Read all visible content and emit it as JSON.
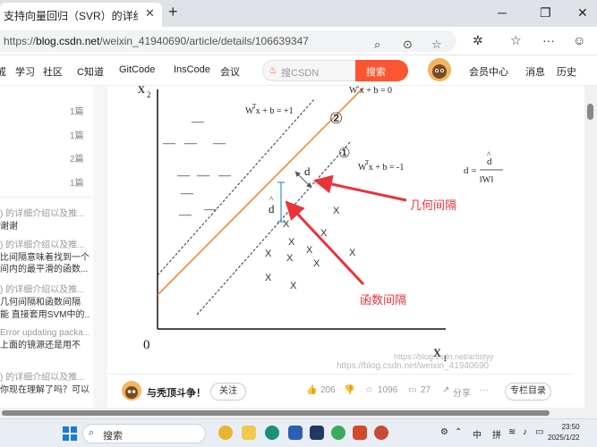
{
  "browser": {
    "tab_title": "支持向量回归（SVR）的详细介绍",
    "tab_close": "✕",
    "new_tab": "+",
    "url_prefix": "https://",
    "url_host": "blog.csdn.net",
    "url_path": "/weixin_41940690/article/details/106639347"
  },
  "header": {
    "nav": [
      "戒",
      "学习",
      "社区",
      "C知道",
      "GitCode",
      "InsCode",
      "会议"
    ],
    "search_placeholder": "搜CSDN",
    "search_button": "搜索",
    "right": [
      "会员中心",
      "消息",
      "历史"
    ]
  },
  "sidebar": {
    "counts": [
      "1篇",
      "1篇",
      "2篇",
      "1篇"
    ],
    "related": [
      {
        "text": ") 的详细介绍以及推...",
        "style": "gray"
      },
      {
        "text": "谢谢",
        "style": "dark"
      },
      {
        "text": ") 的详细介绍以及推...",
        "style": "gray"
      },
      {
        "text": "比间隔意味着找到一个",
        "style": "dark"
      },
      {
        "text": "间内的最平滑的函数...",
        "style": "dark"
      },
      {
        "text": ") 的详细介绍以及推...",
        "style": "gray"
      },
      {
        "text": "几何间隔和函数间隔",
        "style": "dark"
      },
      {
        "text": "能 直接套用SVM中的...",
        "style": "dark"
      },
      {
        "text": "Error updating packa...",
        "style": "gray"
      },
      {
        "text": "上面的镜源还是用不",
        "style": "dark"
      },
      {
        "text": ") 的详细介绍以及推...",
        "style": "gray"
      },
      {
        "text": "你现在理解了吗？可以",
        "style": "dark"
      }
    ]
  },
  "figure": {
    "eq_upper": "W  x + b = +1",
    "eq_mid": "W  x + b = 0",
    "eq_lower": "W  x + b = -1",
    "sup_t": "T",
    "circle_2": "②",
    "circle_1": "①",
    "d_label": "d",
    "dhat_label": "d",
    "hat": "^",
    "formula_left": "d =",
    "formula_num": "d",
    "formula_den": "‖W‖",
    "label_geometric": "几何间隔",
    "label_functional": "函数间隔",
    "axis_x": "x",
    "axis_x_sub": "1",
    "axis_y": "x",
    "axis_y_sub": "2",
    "origin": "0",
    "minus_mark": "—",
    "cross_mark": "X",
    "watermark_1": "https://blog.csdn.net/artistyy",
    "watermark_2": "https://blog.csdn.net/weixin_41940690",
    "colors": {
      "hyperplane": "#f08a3c",
      "arrow": "#e8343a",
      "margin": "#333333",
      "dhat_bracket": "#4aa3df"
    }
  },
  "toolbar": {
    "author": "与秃顶斗争！",
    "follow": "关注",
    "likes": "206",
    "stars": "1096",
    "comments": "27",
    "share": "分享",
    "more": "···",
    "catalog": "专栏目录"
  },
  "taskbar": {
    "search": "搜索",
    "ime_zh": "中",
    "ime_pin": "拼",
    "time": "23:50",
    "date": "2025/1/22"
  }
}
